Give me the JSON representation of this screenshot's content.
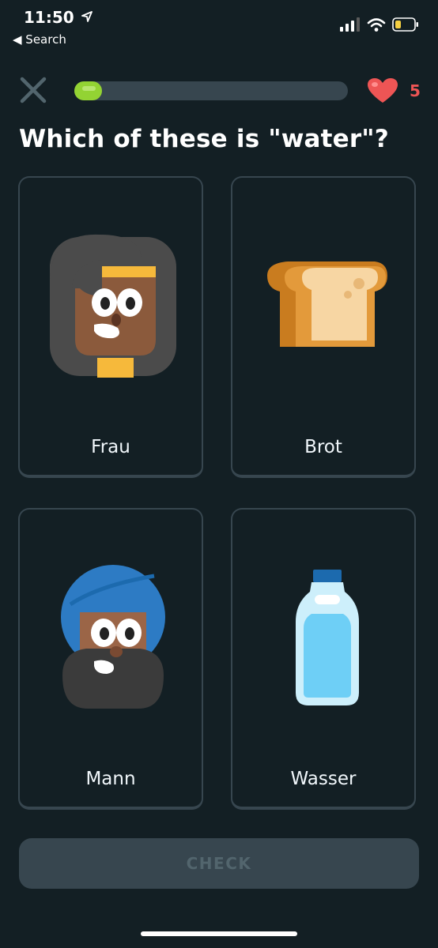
{
  "status_bar": {
    "time": "11:50",
    "back_label": "◀ Search"
  },
  "lesson": {
    "progress_fraction": 0.1,
    "hearts": "5",
    "question": "Which of these is \"water\"?"
  },
  "options": [
    {
      "label": "Frau",
      "icon": "woman-icon"
    },
    {
      "label": "Brot",
      "icon": "bread-icon"
    },
    {
      "label": "Mann",
      "icon": "man-turban-icon"
    },
    {
      "label": "Wasser",
      "icon": "water-bottle-icon"
    }
  ],
  "check_label": "CHECK",
  "colors": {
    "background": "#131f24",
    "progress_fill": "#93d333",
    "heart": "#ee5555",
    "card_border": "#37464f"
  }
}
